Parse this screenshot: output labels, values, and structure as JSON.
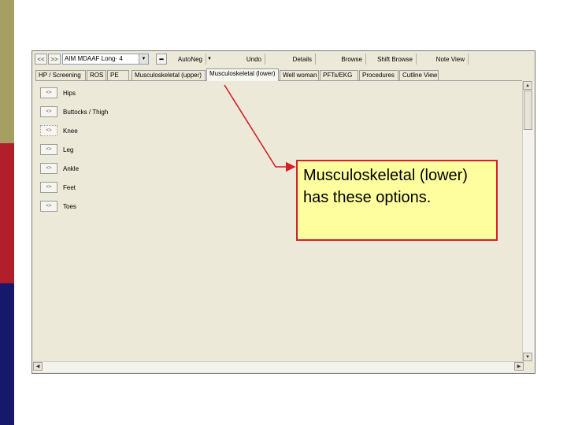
{
  "toolbar": {
    "back_label": "<<",
    "forward_label": ">>",
    "template_value": "AIM  MDAAF Long·  4",
    "minus_label": "━",
    "autoneg_label": "AutoNeg",
    "undo_label": "Undo",
    "details_label": "Details",
    "browse_label": "Browse",
    "shift_browse_label": "Shift Browse",
    "note_view_label": "Note View"
  },
  "tabs": [
    {
      "label": "HP / Screening"
    },
    {
      "label": "ROS"
    },
    {
      "label": "PE"
    },
    {
      "label": "Musculoskeletal (upper)"
    },
    {
      "label": "Musculoskeletal (lower)"
    },
    {
      "label": "Well woman"
    },
    {
      "label": "PFTs/EKG"
    },
    {
      "label": "Procedures"
    },
    {
      "label": "Cutline View"
    }
  ],
  "options": [
    {
      "label": "Hips",
      "button": "<>"
    },
    {
      "label": "Buttocks / Thigh",
      "button": "<>"
    },
    {
      "label": "Knee",
      "button": "<>"
    },
    {
      "label": "Leg",
      "button": "<>"
    },
    {
      "label": "Ankle",
      "button": "<>"
    },
    {
      "label": "Feet",
      "button": "<>"
    },
    {
      "label": "Toes",
      "button": "<>"
    }
  ],
  "scroll": {
    "up": "▲",
    "down": "▼",
    "left": "◀",
    "right": "▶"
  },
  "callout": {
    "text": "Musculoskeletal (lower) has these options."
  },
  "colors": {
    "callout_bg": "#fefe9e",
    "callout_border": "#d3202a",
    "window_bg": "#ece9d8"
  }
}
